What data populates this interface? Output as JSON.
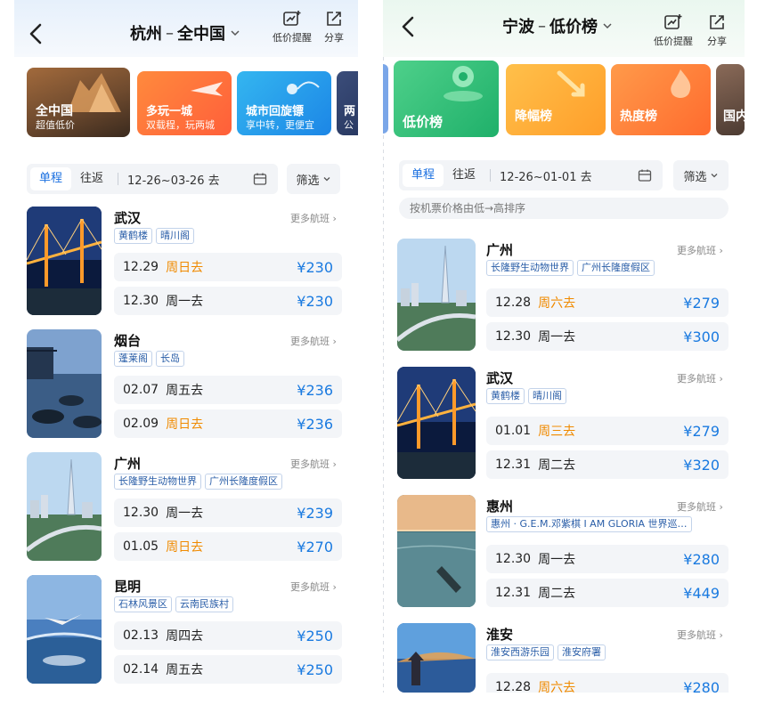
{
  "left": {
    "header": {
      "from_city": "杭州",
      "to_city": "全中国",
      "alert_label": "低价提醒",
      "share_label": "分享"
    },
    "banners": [
      {
        "title": "全中国",
        "subtitle": "超值低价"
      },
      {
        "title": "多玩一城",
        "subtitle": "双载程，玩两城"
      },
      {
        "title": "城市回旋镖",
        "subtitle": "享中转，更便宜"
      },
      {
        "title": "两",
        "subtitle": "公"
      }
    ],
    "filter": {
      "one_way": "单程",
      "round_trip": "往返",
      "date_range": "12-26~03-26 去",
      "screen": "筛选"
    },
    "destinations": [
      {
        "city": "武汉",
        "more": "更多航班",
        "tags": [
          "黄鹤楼",
          "晴川阁"
        ],
        "fares": [
          {
            "date": "12.29",
            "weekday": "周日去",
            "price": "¥230",
            "highlight": true
          },
          {
            "date": "12.30",
            "weekday": "周一去",
            "price": "¥230",
            "highlight": false
          }
        ]
      },
      {
        "city": "烟台",
        "more": "更多航班",
        "tags": [
          "蓬莱阁",
          "长岛"
        ],
        "fares": [
          {
            "date": "02.07",
            "weekday": "周五去",
            "price": "¥236",
            "highlight": false
          },
          {
            "date": "02.09",
            "weekday": "周日去",
            "price": "¥236",
            "highlight": true
          }
        ]
      },
      {
        "city": "广州",
        "more": "更多航班",
        "tags": [
          "长隆野生动物世界",
          "广州长隆度假区"
        ],
        "fares": [
          {
            "date": "12.30",
            "weekday": "周一去",
            "price": "¥239",
            "highlight": false
          },
          {
            "date": "01.05",
            "weekday": "周日去",
            "price": "¥270",
            "highlight": true
          }
        ]
      },
      {
        "city": "昆明",
        "more": "更多航班",
        "tags": [
          "石林风景区",
          "云南民族村"
        ],
        "fares": [
          {
            "date": "02.13",
            "weekday": "周四去",
            "price": "¥250",
            "highlight": false
          },
          {
            "date": "02.14",
            "weekday": "周五去",
            "price": "¥250",
            "highlight": false
          }
        ]
      }
    ]
  },
  "right": {
    "header": {
      "from_city": "宁波",
      "to_city": "低价榜",
      "alert_label": "低价提醒",
      "share_label": "分享"
    },
    "banners": [
      {
        "title": "低价榜"
      },
      {
        "title": "降幅榜"
      },
      {
        "title": "热度榜"
      },
      {
        "title": "国内"
      }
    ],
    "filter": {
      "one_way": "单程",
      "round_trip": "往返",
      "date_range": "12-26~01-01 去",
      "screen": "筛选",
      "sort_hint": "按机票价格由低→高排序"
    },
    "destinations": [
      {
        "city": "广州",
        "more": "更多航班",
        "tags": [
          "长隆野生动物世界",
          "广州长隆度假区"
        ],
        "fares": [
          {
            "date": "12.28",
            "weekday": "周六去",
            "price": "¥279",
            "highlight": true
          },
          {
            "date": "12.30",
            "weekday": "周一去",
            "price": "¥300",
            "highlight": false
          }
        ]
      },
      {
        "city": "武汉",
        "more": "更多航班",
        "tags": [
          "黄鹤楼",
          "晴川阁"
        ],
        "fares": [
          {
            "date": "01.01",
            "weekday": "周三去",
            "price": "¥279",
            "highlight": true
          },
          {
            "date": "12.31",
            "weekday": "周二去",
            "price": "¥320",
            "highlight": false
          }
        ]
      },
      {
        "city": "惠州",
        "more": "更多航班",
        "tags": [
          "惠州 · G.E.M.邓紫棋 I AM GLORIA 世界巡…"
        ],
        "fares": [
          {
            "date": "12.30",
            "weekday": "周一去",
            "price": "¥280",
            "highlight": false
          },
          {
            "date": "12.31",
            "weekday": "周二去",
            "price": "¥449",
            "highlight": false
          }
        ]
      },
      {
        "city": "淮安",
        "more": "更多航班",
        "tags": [
          "淮安西游乐园",
          "淮安府署"
        ],
        "fares": [
          {
            "date": "12.28",
            "weekday": "周六去",
            "price": "¥280",
            "highlight": true
          }
        ]
      }
    ]
  },
  "colors": {
    "accent": "#1a7ae0",
    "highlight": "#f08a00",
    "tag_text": "#2a5ea8"
  }
}
